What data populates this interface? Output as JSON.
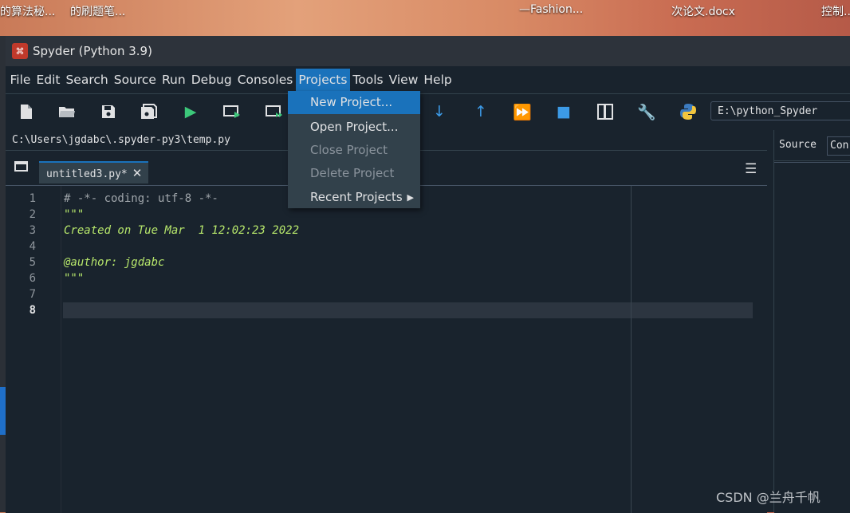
{
  "desktop": {
    "labels": [
      "的算法秘...",
      "的刷题笔...",
      "—Fashion...",
      "次论文.docx",
      "控制..."
    ]
  },
  "window": {
    "title": "Spyder (Python 3.9)"
  },
  "menubar": {
    "items": [
      "File",
      "Edit",
      "Search",
      "Source",
      "Run",
      "Debug",
      "Consoles",
      "Projects",
      "Tools",
      "View",
      "Help"
    ],
    "active": "Projects"
  },
  "toolbar": {
    "icons": [
      "new-file-icon",
      "open-folder-icon",
      "save-icon",
      "save-all-icon",
      "run-icon",
      "run-cell-icon",
      "run-cell-advance-icon",
      "step-into-icon",
      "step-return-icon",
      "continue-icon",
      "stop-icon",
      "maximize-pane-icon",
      "preferences-wrench-icon",
      "python-path-icon"
    ],
    "working_dir": "E:\\python_Spyder"
  },
  "editor": {
    "file_path": "C:\\Users\\jgdabc\\.spyder-py3\\temp.py",
    "tab_label": "untitled3.py*",
    "tab_close": "✕",
    "current_line": 8,
    "lines": [
      {
        "n": "1",
        "text": "# -*- coding: utf-8 -*-",
        "style": "comment"
      },
      {
        "n": "2",
        "text": "\"\"\"",
        "style": "doc"
      },
      {
        "n": "3",
        "text": "Created on Tue Mar  1 12:02:23 2022",
        "style": "doc"
      },
      {
        "n": "4",
        "text": "",
        "style": "doc"
      },
      {
        "n": "5",
        "text": "@author: jgdabc",
        "style": "doc"
      },
      {
        "n": "6",
        "text": "\"\"\"",
        "style": "doc"
      },
      {
        "n": "7",
        "text": "",
        "style": "doc"
      },
      {
        "n": "8",
        "text": "",
        "style": "plain"
      }
    ]
  },
  "right_panel": {
    "source_label": "Source",
    "combo_text": "Con"
  },
  "projects_menu": {
    "items": [
      {
        "label": "New Project...",
        "state": "highlighted"
      },
      {
        "label": "Open Project...",
        "state": "enabled"
      },
      {
        "label": "Close Project",
        "state": "disabled"
      },
      {
        "label": "Delete Project",
        "state": "disabled"
      },
      {
        "label": "Recent Projects",
        "state": "submenu"
      }
    ]
  },
  "watermark": "CSDN @兰舟千帆"
}
